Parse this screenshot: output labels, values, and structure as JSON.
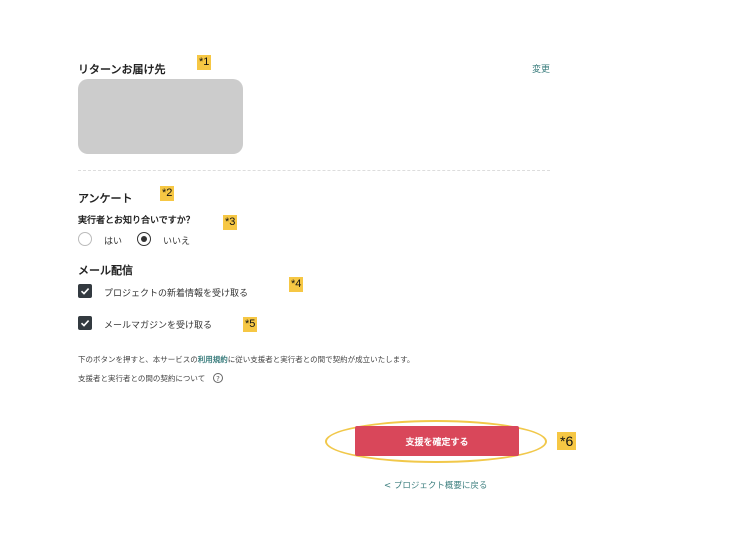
{
  "shipping": {
    "title": "リターンお届け先",
    "change_label": "変更",
    "annotation": "*1"
  },
  "survey": {
    "title": "アンケート",
    "annotation": "*2",
    "question": "実行者とお知り合いですか？",
    "question_annotation": "*3",
    "options": [
      {
        "label": "はい",
        "selected": false
      },
      {
        "label": "いいえ",
        "selected": true
      }
    ]
  },
  "mail": {
    "title": "メール配信",
    "items": [
      {
        "label": "プロジェクトの新着情報を受け取る",
        "checked": true,
        "annotation": "*4"
      },
      {
        "label": "メールマガジンを受け取る",
        "checked": true,
        "annotation": "*5"
      }
    ]
  },
  "terms": {
    "prefix": "下のボタンを押すと、本サービスの",
    "link": "利用規約",
    "suffix": "に従い支援者と実行者との間で契約が成立いたします。",
    "contract_info": "支援者と実行者との間の契約について",
    "help_icon": "?"
  },
  "actions": {
    "confirm_label": "支援を確定する",
    "confirm_annotation": "*6",
    "back_label": "< プロジェクト概要に戻る"
  },
  "colors": {
    "accent": "#d9475a",
    "link": "#3d7f7f",
    "annotation": "#f6c744"
  }
}
